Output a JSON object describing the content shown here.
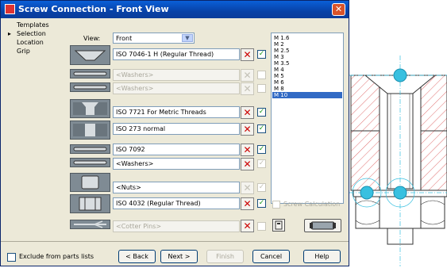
{
  "window": {
    "title": "Screw Connection - Front View",
    "close_glyph": "✕"
  },
  "nav": {
    "items": [
      {
        "label": "Templates",
        "active": false
      },
      {
        "label": "Selection",
        "active": true
      },
      {
        "label": "Location",
        "active": false
      },
      {
        "label": "Grip",
        "active": false
      }
    ],
    "active_marker": "▸"
  },
  "view": {
    "label": "View:",
    "value": "Front"
  },
  "parts": [
    {
      "thumb": "countersunk-screw",
      "value": "ISO 7046-1  H  (Regular Thread)",
      "enabled": true,
      "checked": true
    },
    {
      "thumb": "washer",
      "value": "<Washers>",
      "enabled": false,
      "checked": false
    },
    {
      "thumb": "washer",
      "value": "<Washers>",
      "enabled": false,
      "checked": false
    },
    {
      "thumb": "countersunk-hole",
      "value": "ISO 7721  For Metric Threads",
      "enabled": true,
      "checked": true
    },
    {
      "thumb": "threaded-hole",
      "value": "ISO 273 normal",
      "enabled": true,
      "checked": true
    },
    {
      "thumb": "washer",
      "value": "ISO 7092",
      "enabled": true,
      "checked": true
    },
    {
      "thumb": "washer",
      "value": "<Washers>",
      "enabled": true,
      "checked": false
    },
    {
      "thumb": "nut",
      "value": "<Nuts>",
      "enabled": true,
      "checked": false
    },
    {
      "thumb": "hex-nut",
      "value": "ISO 4032  (Regular Thread)",
      "enabled": true,
      "checked": true
    },
    {
      "thumb": "cotter-pin",
      "value": "<Cotter Pins>",
      "enabled": false,
      "checked": false
    }
  ],
  "sizes": {
    "items": [
      "M 1.6",
      "M 2",
      "M 2.5",
      "M 3",
      "M 3.5",
      "M 4",
      "M 5",
      "M 6",
      "M 8",
      "M 10"
    ],
    "selected": "M 10"
  },
  "screw_calculation": {
    "label": "Screw Calculation",
    "checked": false
  },
  "exclude": {
    "label": "Exclude from parts lists",
    "checked": false
  },
  "buttons": {
    "back": "< Back",
    "next": "Next >",
    "finish": "Finish",
    "cancel": "Cancel",
    "help": "Help"
  },
  "colors": {
    "titlebar": "#0842a8",
    "dialog_bg": "#ece9d8",
    "selected": "#316ac5",
    "hatch": "#e07070",
    "center_mark": "#38c0e0"
  },
  "glyphs": {
    "x": "✕",
    "check": "✓"
  }
}
